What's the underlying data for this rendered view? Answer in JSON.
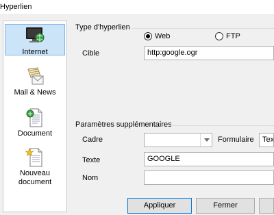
{
  "window": {
    "title": "Hyperlien"
  },
  "sidebar": {
    "items": [
      {
        "label": "Internet",
        "icon": "globe-monitor-icon",
        "selected": true
      },
      {
        "label": "Mail & News",
        "icon": "mail-news-icon",
        "selected": false
      },
      {
        "label": "Document",
        "icon": "document-icon",
        "selected": false
      },
      {
        "label": "Nouveau document",
        "label_line1": "Nouveau",
        "label_line2": "document",
        "icon": "new-document-icon",
        "selected": false
      }
    ]
  },
  "hyperlink_type": {
    "title": "Type d'hyperlien",
    "options": [
      {
        "label": "Web",
        "selected": true
      },
      {
        "label": "FTP",
        "selected": false
      }
    ]
  },
  "target": {
    "label": "Cible",
    "value": "http:google.ogr"
  },
  "extra": {
    "title": "Paramètres supplémentaires",
    "frame": {
      "label": "Cadre",
      "value": ""
    },
    "form": {
      "label": "Formulaire",
      "value": "Text"
    },
    "text": {
      "label": "Texte",
      "value": "GOOGLE"
    },
    "name": {
      "label": "Nom",
      "value": ""
    }
  },
  "buttons": {
    "apply": "Appliquer",
    "close": "Fermer"
  },
  "colors": {
    "selection_bg": "#cce4f7",
    "selection_border": "#7eb4ea",
    "dialog_bg": "#f0f0f0"
  }
}
